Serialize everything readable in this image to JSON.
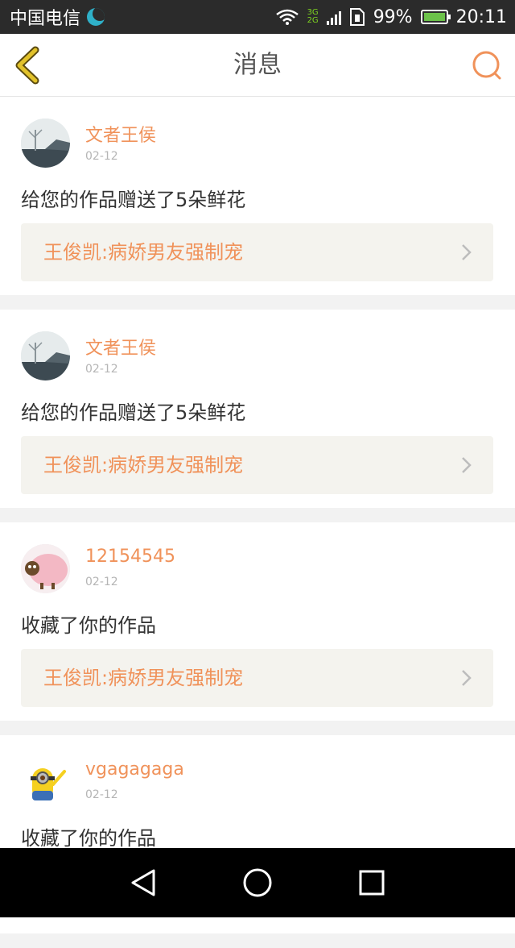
{
  "status_bar": {
    "carrier": "中国电信",
    "network_top": "3G",
    "network_bottom": "2G",
    "battery": "99%",
    "time": "20:11"
  },
  "header": {
    "title": "消息"
  },
  "colors": {
    "accent": "#f0925a",
    "back": "#c8a21c"
  },
  "messages": [
    {
      "username": "文者王侯",
      "date": "02-12",
      "text": "给您的作品赠送了5朵鲜花",
      "work_title": "王俊凯:病娇男友强制宠",
      "avatar": "landscape-avatar"
    },
    {
      "username": "文者王侯",
      "date": "02-12",
      "text": "给您的作品赠送了5朵鲜花",
      "work_title": "王俊凯:病娇男友强制宠",
      "avatar": "landscape-avatar"
    },
    {
      "username": "12154545",
      "date": "02-12",
      "text": "收藏了你的作品",
      "work_title": "王俊凯:病娇男友强制宠",
      "avatar": "sheep-avatar"
    },
    {
      "username": "vgagagaga",
      "date": "02-12",
      "text": "收藏了你的作品",
      "work_title": "",
      "avatar": "minion-avatar"
    }
  ]
}
